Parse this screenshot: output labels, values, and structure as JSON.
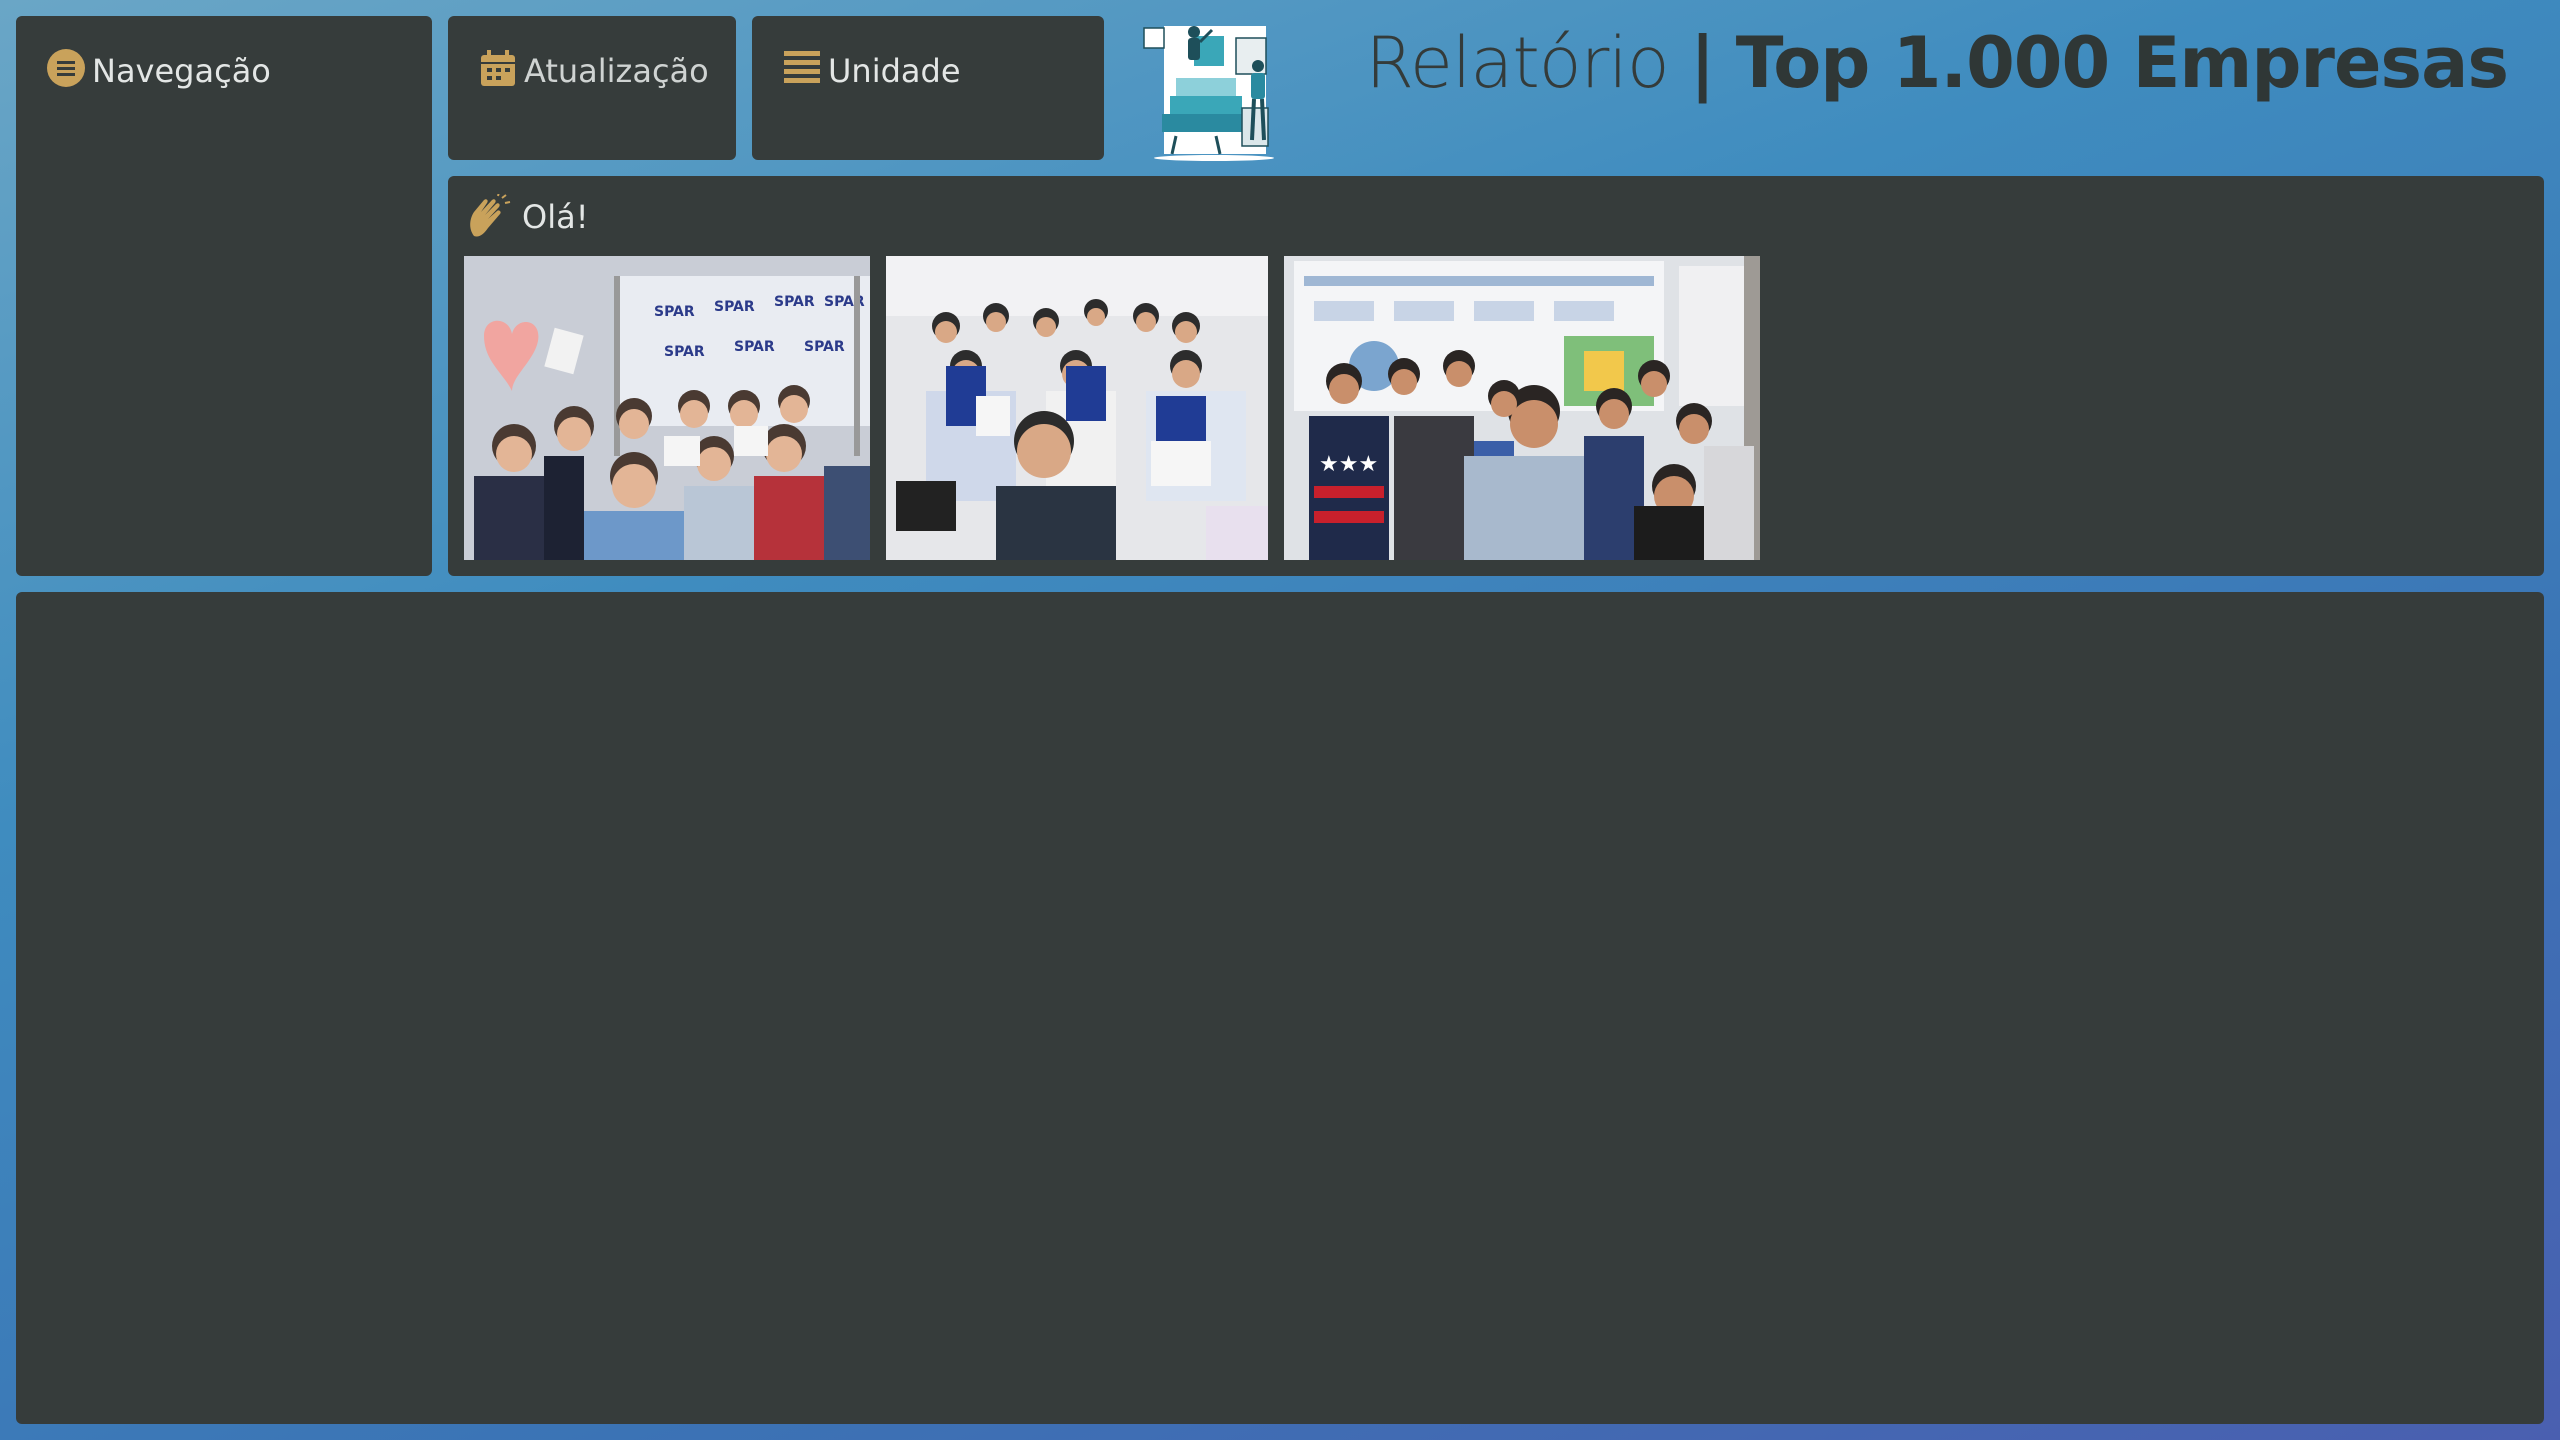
{
  "nav": {
    "label": "Navegação",
    "icon": "menu-circle-icon"
  },
  "buttons": [
    {
      "label": "Atualização",
      "icon": "calendar-icon"
    },
    {
      "label": "Unidade",
      "icon": "list-icon"
    }
  ],
  "header": {
    "title_light": "Relatório",
    "separator": "|",
    "title_bold": "Top 1.000 Empresas"
  },
  "welcome": {
    "label": "Olá!",
    "icon": "clapping-hands-icon"
  },
  "photos": [
    {
      "icon": "group-photo-icon"
    },
    {
      "icon": "group-photo-icon"
    },
    {
      "icon": "group-photo-icon"
    }
  ],
  "colors": {
    "panel": "#363c3b",
    "accent": "#c9a25b",
    "text": "#e3e6e5",
    "title": "#2f3736"
  }
}
